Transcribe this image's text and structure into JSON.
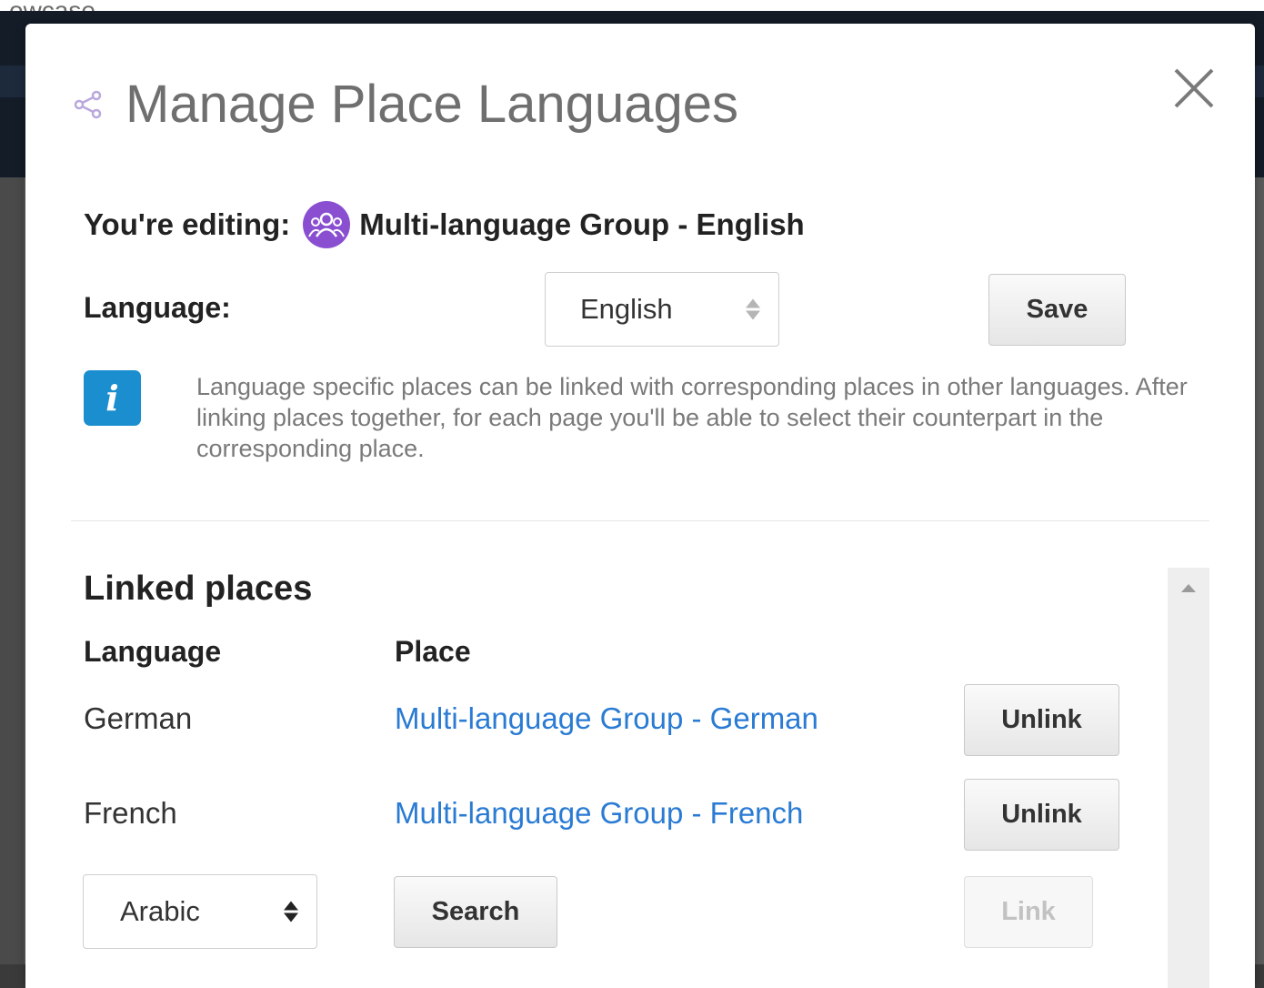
{
  "background": {
    "page_text": "owcase"
  },
  "modal": {
    "title": "Manage Place Languages",
    "editing_label": "You're editing:",
    "editing_place": "Multi-language Group - English",
    "language_label": "Language:",
    "language_select": {
      "selected": "English"
    },
    "save_label": "Save",
    "info_text": "Language specific places can be linked with corresponding places in other languages. After linking places together, for each page you'll be able to select their counterpart in the corresponding place."
  },
  "linked": {
    "title": "Linked places",
    "headers": {
      "language": "Language",
      "place": "Place"
    },
    "rows": [
      {
        "language": "German",
        "place": "Multi-language Group - German",
        "action": "Unlink"
      },
      {
        "language": "French",
        "place": "Multi-language Group - French",
        "action": "Unlink"
      }
    ],
    "add_row": {
      "language_select": "Arabic",
      "search_label": "Search",
      "link_label": "Link"
    }
  },
  "colors": {
    "accent_link": "#2a7bd3",
    "info_icon": "#1b8ed0",
    "group_avatar": "#8a4fd1",
    "share_icon": "#b9a8dd"
  },
  "icons": {
    "share": "share-icon",
    "close": "close-icon",
    "info": "info-icon",
    "group": "group-icon"
  }
}
